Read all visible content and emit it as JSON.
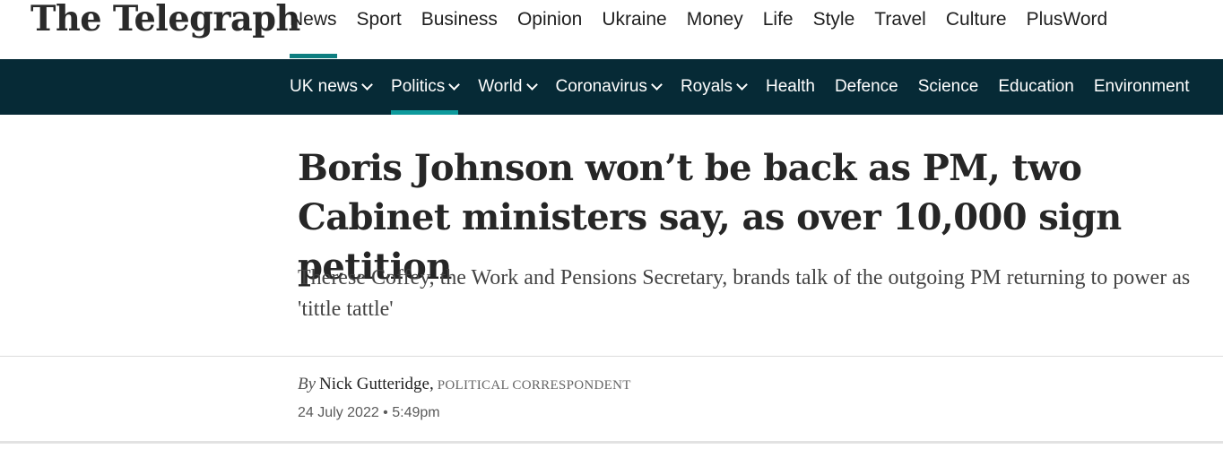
{
  "masthead": {
    "logo_text": "The Telegraph"
  },
  "primary_nav": {
    "items": [
      {
        "label": "News",
        "active": true
      },
      {
        "label": "Sport"
      },
      {
        "label": "Business"
      },
      {
        "label": "Opinion"
      },
      {
        "label": "Ukraine"
      },
      {
        "label": "Money"
      },
      {
        "label": "Life"
      },
      {
        "label": "Style"
      },
      {
        "label": "Travel"
      },
      {
        "label": "Culture"
      },
      {
        "label": "PlusWord"
      }
    ]
  },
  "secondary_nav": {
    "items": [
      {
        "label": "UK news",
        "has_dropdown": true
      },
      {
        "label": "Politics",
        "has_dropdown": true,
        "active": true
      },
      {
        "label": "World",
        "has_dropdown": true
      },
      {
        "label": "Coronavirus",
        "has_dropdown": true
      },
      {
        "label": "Royals",
        "has_dropdown": true
      },
      {
        "label": "Health"
      },
      {
        "label": "Defence"
      },
      {
        "label": "Science"
      },
      {
        "label": "Education"
      },
      {
        "label": "Environment"
      }
    ],
    "dropdown_icon": "chevron-down-icon"
  },
  "article": {
    "headline": "Boris Johnson won’t be back as PM, two Cabinet ministers say, as over 10,000 sign petition",
    "standfirst": "Therese Coffey, the Work and Pensions Secretary, brands talk of the outgoing PM returning to power as 'tittle tattle'",
    "byline": {
      "prefix": "By",
      "author": "Nick Gutteridge,",
      "role": "POLITICAL CORRESPONDENT"
    },
    "date": "24 July 2022 • 5:49pm"
  },
  "colors": {
    "nav_background": "#062a36",
    "accent": "#0e7e80",
    "headline_text": "#262626"
  }
}
